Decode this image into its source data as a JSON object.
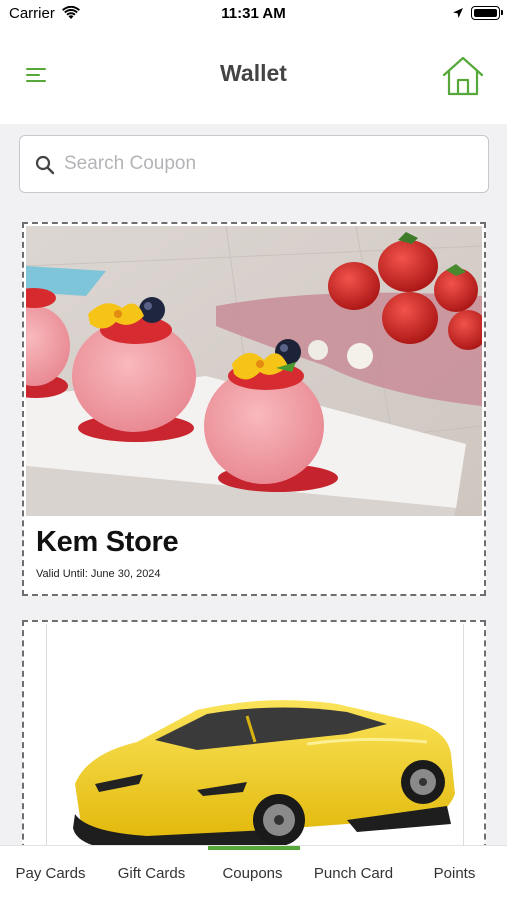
{
  "status_bar": {
    "carrier": "Carrier",
    "time": "11:31 AM"
  },
  "header": {
    "title": "Wallet"
  },
  "search": {
    "placeholder": "Search Coupon",
    "value": ""
  },
  "coupons": [
    {
      "title": "Kem Store",
      "valid_until": "Valid Until: June 30, 2024",
      "image": "ice-cream-dessert-image"
    },
    {
      "title": "",
      "valid_until": "",
      "image": "yellow-sports-car-image"
    }
  ],
  "tabs": [
    {
      "label": "Pay Cards",
      "active": false
    },
    {
      "label": "Gift Cards",
      "active": false
    },
    {
      "label": "Coupons",
      "active": true
    },
    {
      "label": "Punch Card",
      "active": false
    },
    {
      "label": "Points",
      "active": false
    }
  ],
  "colors": {
    "accent": "#56a83a",
    "background": "#f1f1f4",
    "title": "#444444"
  }
}
